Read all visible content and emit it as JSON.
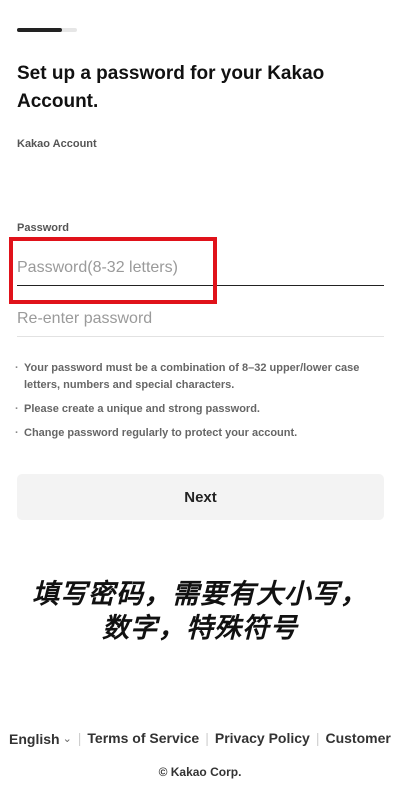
{
  "progress": {
    "fraction": 0.75
  },
  "title": "Set up a password for your Kakao Account.",
  "account_label": "Kakao Account",
  "password": {
    "label": "Password",
    "placeholder": "Password(8-32 letters)",
    "reenter_placeholder": "Re-enter password"
  },
  "tips": [
    "Your password must be a combination of 8–32 upper/lower case letters, numbers and special characters.",
    "Please create a unique and strong password.",
    "Change password regularly to protect your account."
  ],
  "next_label": "Next",
  "caption": "填写密码，需要有大小写，数字，特殊符号",
  "highlight_color": "#e0121a",
  "footer": {
    "language": "English",
    "language_icon": "chevron-down-icon",
    "terms": "Terms of Service",
    "privacy": "Privacy Policy",
    "customer": "Customer"
  },
  "copyright": "© Kakao Corp."
}
